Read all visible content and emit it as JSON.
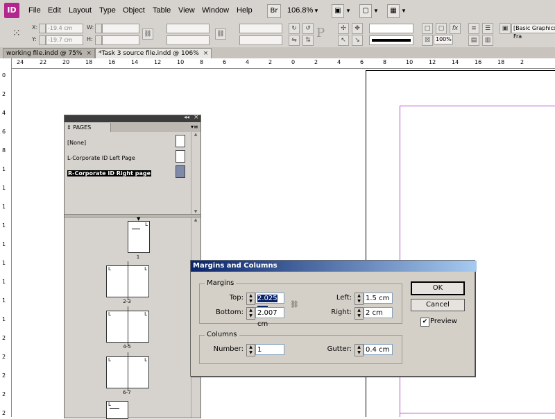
{
  "app": {
    "logo": "ID",
    "menu": [
      "File",
      "Edit",
      "Layout",
      "Type",
      "Object",
      "Table",
      "View",
      "Window",
      "Help"
    ],
    "bridge_label": "Br",
    "zoom": "106.8%"
  },
  "controlbar": {
    "x_label": "X:",
    "x_value": "-19.4 cm",
    "y_label": "Y:",
    "y_value": "-19.7 cm",
    "w_label": "W:",
    "h_label": "H:",
    "scale_x": "100%",
    "style_value": "[Basic Graphics Fra"
  },
  "tabs": [
    {
      "label": "working file.indd @ 75%",
      "close": "×"
    },
    {
      "label": "*Task 3 source file.indd @ 106%",
      "close": "×"
    }
  ],
  "ruler_h": [
    "24",
    "22",
    "20",
    "18",
    "16",
    "14",
    "12",
    "10",
    "8",
    "6",
    "4",
    "2",
    "0",
    "2",
    "4",
    "6",
    "8",
    "10",
    "12",
    "14",
    "16",
    "18",
    "2"
  ],
  "ruler_v": [
    "0",
    "2",
    "4",
    "6",
    "8",
    "1",
    "1",
    "1",
    "1",
    "1",
    "1",
    "1",
    "1",
    "1",
    "2",
    "2",
    "2",
    "2",
    "2"
  ],
  "pages_panel": {
    "title": "PAGES",
    "masters": [
      "[None]",
      "L-Corporate ID Left Page",
      "R-Corporate ID Right page"
    ],
    "selected_master_index": 2,
    "page_labels": [
      "1",
      "2-3",
      "4-5",
      "6-7"
    ]
  },
  "dialog": {
    "title": "Margins and Columns",
    "margins_group": "Margins",
    "top_label": "Top:",
    "top_value": "2.025 cm",
    "bottom_label": "Bottom:",
    "bottom_value": "2.007 cm",
    "left_label": "Left:",
    "left_value": "1.5 cm",
    "right_label": "Right:",
    "right_value": "2 cm",
    "columns_group": "Columns",
    "number_label": "Number:",
    "number_value": "1",
    "gutter_label": "Gutter:",
    "gutter_value": "0.4 cm",
    "ok": "OK",
    "cancel": "Cancel",
    "preview": "Preview",
    "preview_checked": true
  }
}
